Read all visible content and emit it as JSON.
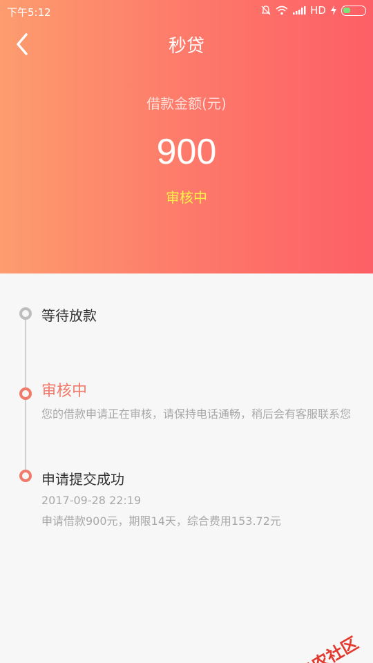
{
  "status_bar": {
    "time": "下午5:12",
    "network": "HD"
  },
  "header": {
    "title": "秒贷",
    "amount_label": "借款金额(元)",
    "amount": "900",
    "status": "审核中"
  },
  "timeline": {
    "steps": [
      {
        "title": "等待放款"
      },
      {
        "title": "审核中",
        "desc": "您的借款申请正在审核，请保持电话通畅，稍后会有客服联系您"
      },
      {
        "title": "申请提交成功",
        "time": "2017-09-28 22:19",
        "desc": "申请借款900元，期限14天，综合费用153.72元"
      }
    ]
  },
  "watermark": {
    "text": "卡农社区"
  },
  "colors": {
    "gradient_start": "#fd9c6e",
    "gradient_end": "#fd5f66",
    "accent": "#f07a6a",
    "status_yellow": "#fff04a"
  }
}
